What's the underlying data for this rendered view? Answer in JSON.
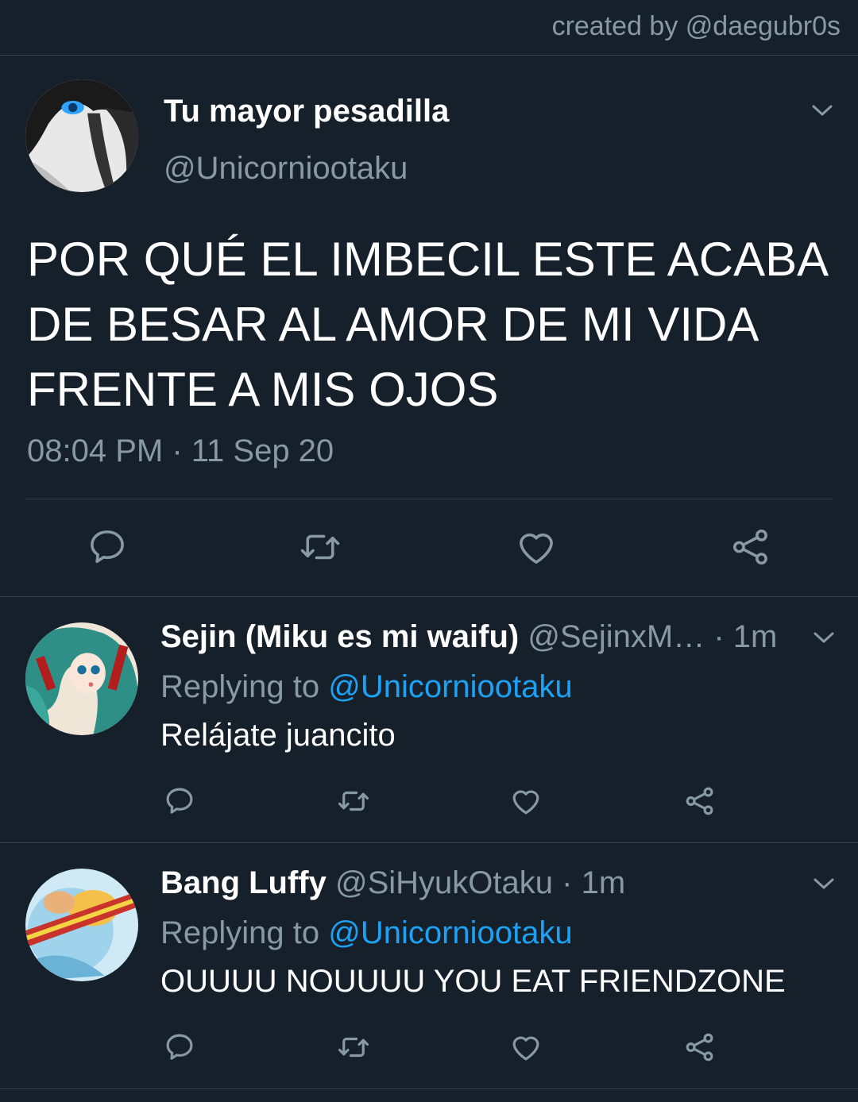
{
  "header": {
    "credit": "created by @daegubr0s"
  },
  "main_tweet": {
    "display_name": "Tu mayor pesadilla",
    "handle": "@Unicorniootaku",
    "text_lines": [
      "POR QUÉ EL IMBECIL ESTE ACABA",
      "DE BESAR AL AMOR DE MI VIDA",
      "FRENTE A MIS OJOS"
    ],
    "timestamp": "08:04 PM · 11 Sep 20",
    "actions": [
      "reply-icon",
      "retweet-icon",
      "like-icon",
      "share-icon"
    ]
  },
  "replies": [
    {
      "display_name": "Sejin (Miku es mi waifu)",
      "handle": "@SejinxM…",
      "time": " · 1m",
      "replying_prefix": "Replying to ",
      "replying_to": "@Unicorniootaku",
      "text": "Relájate juancito"
    },
    {
      "display_name": "Bang Luffy",
      "handle": "@SiHyukOtaku",
      "time": " · 1m",
      "replying_prefix": "Replying to ",
      "replying_to": "@Unicorniootaku",
      "text": "OUUUU NOUUUU YOU EAT FRIENDZONE"
    }
  ],
  "colors": {
    "background": "#15202b",
    "muted": "#8899a6",
    "accent": "#1da1f2",
    "divider": "#38444d"
  }
}
